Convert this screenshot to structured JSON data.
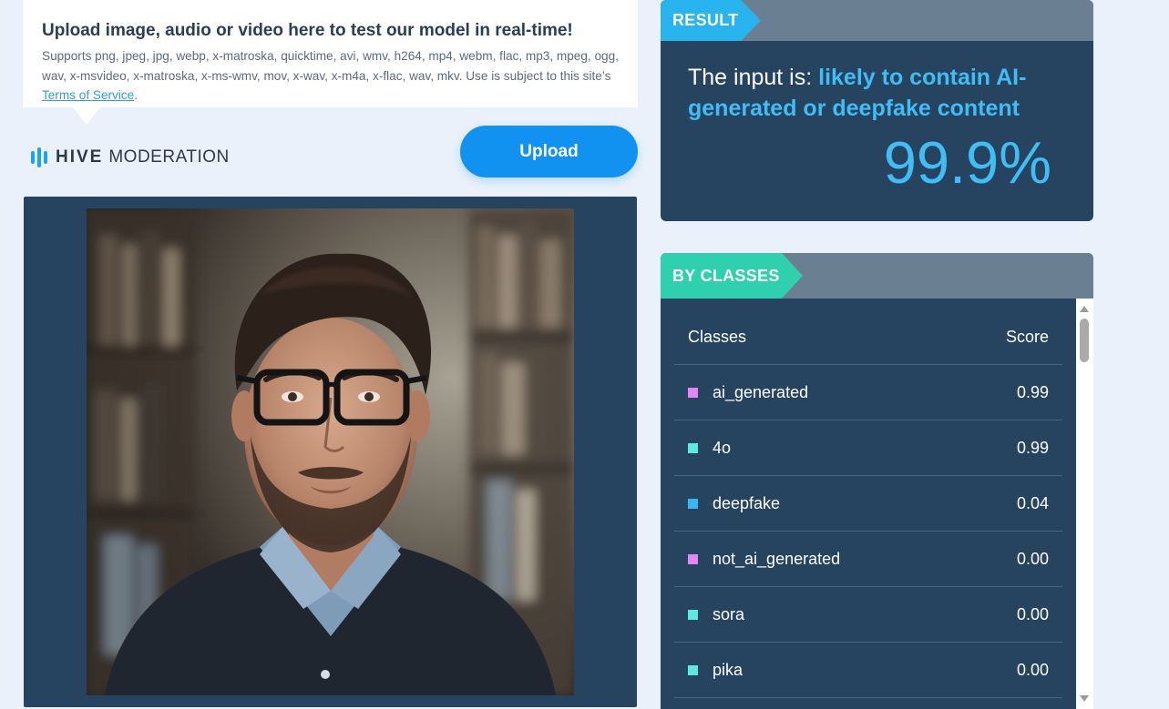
{
  "info": {
    "title": "Upload image, audio or video here to test our model in real-time!",
    "supports_text": "Supports png, jpeg, jpg, webp, x-matroska, quicktime, avi, wmv, h264, mp4, webm, flac, mp3, mpeg, ogg, wav, x-msvideo, x-matroska, x-ms-wmv, mov, x-wav, x-m4a, x-flac, wav, mkv. Use is subject to this site’s ",
    "terms_link": "Terms of Service",
    "terms_suffix": "."
  },
  "logo": {
    "hive": "HIVE",
    "moderation": "MODERATION",
    "icon": "hive-bars-icon"
  },
  "upload_button": "Upload",
  "preview": {
    "image": "portrait-photo"
  },
  "result": {
    "tag": "RESULT",
    "prefix": "The input is: ",
    "verdict": "likely to contain AI-generated or deepfake content",
    "percent": "99.9%"
  },
  "classes": {
    "tag": "BY CLASSES",
    "header_class": "Classes",
    "header_score": "Score",
    "rows": [
      {
        "name": "ai_generated",
        "score": "0.99",
        "color": "#e587f2"
      },
      {
        "name": "4o",
        "score": "0.99",
        "color": "#5ee9e0"
      },
      {
        "name": "deepfake",
        "score": "0.04",
        "color": "#37b8f2"
      },
      {
        "name": "not_ai_generated",
        "score": "0.00",
        "color": "#e587f2"
      },
      {
        "name": "sora",
        "score": "0.00",
        "color": "#5ee9e0"
      },
      {
        "name": "pika",
        "score": "0.00",
        "color": "#5ee9e0"
      }
    ]
  },
  "colors": {
    "accent_blue": "#1292f0",
    "panel": "#264460",
    "highlight": "#3fbdf5",
    "result_tag": "#28b4ee",
    "classes_tag": "#2fd0ae"
  }
}
